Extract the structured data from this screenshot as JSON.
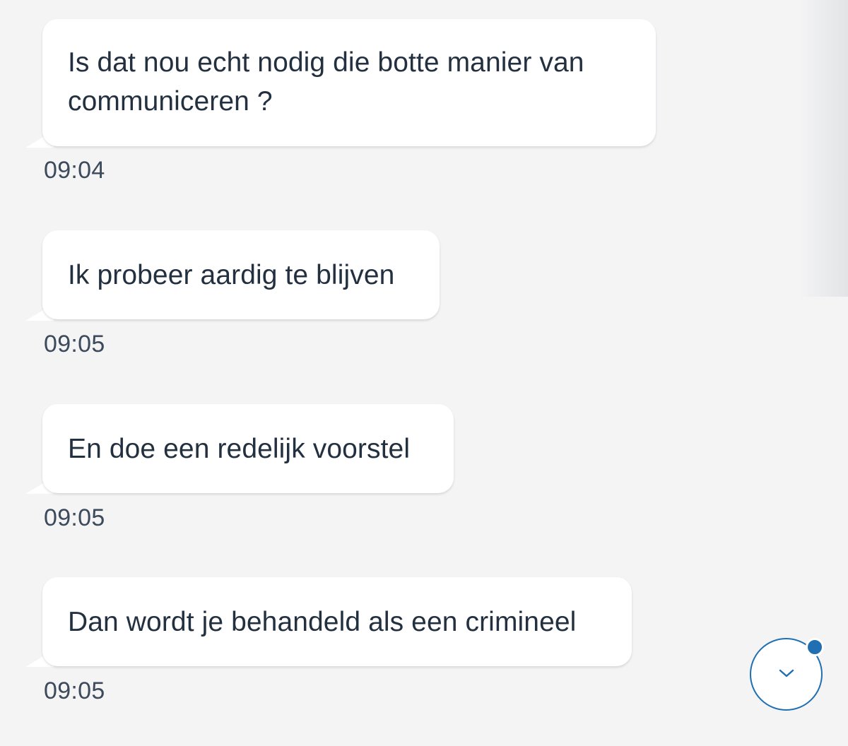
{
  "messages": [
    {
      "lines": [
        "Is dat nou echt nodig die botte manier van",
        "communiceren ?"
      ],
      "time": "09:04"
    },
    {
      "lines": [
        "Ik probeer aardig te blijven"
      ],
      "time": "09:05"
    },
    {
      "lines": [
        "En doe een redelijk voorstel"
      ],
      "time": "09:05"
    },
    {
      "lines": [
        "Dan wordt je behandeld als een crimineel"
      ],
      "time": "09:05"
    }
  ],
  "scroll_button": {
    "icon": "chevron-down-icon",
    "has_unread_indicator": true,
    "accent_color": "#1f6fb2"
  }
}
